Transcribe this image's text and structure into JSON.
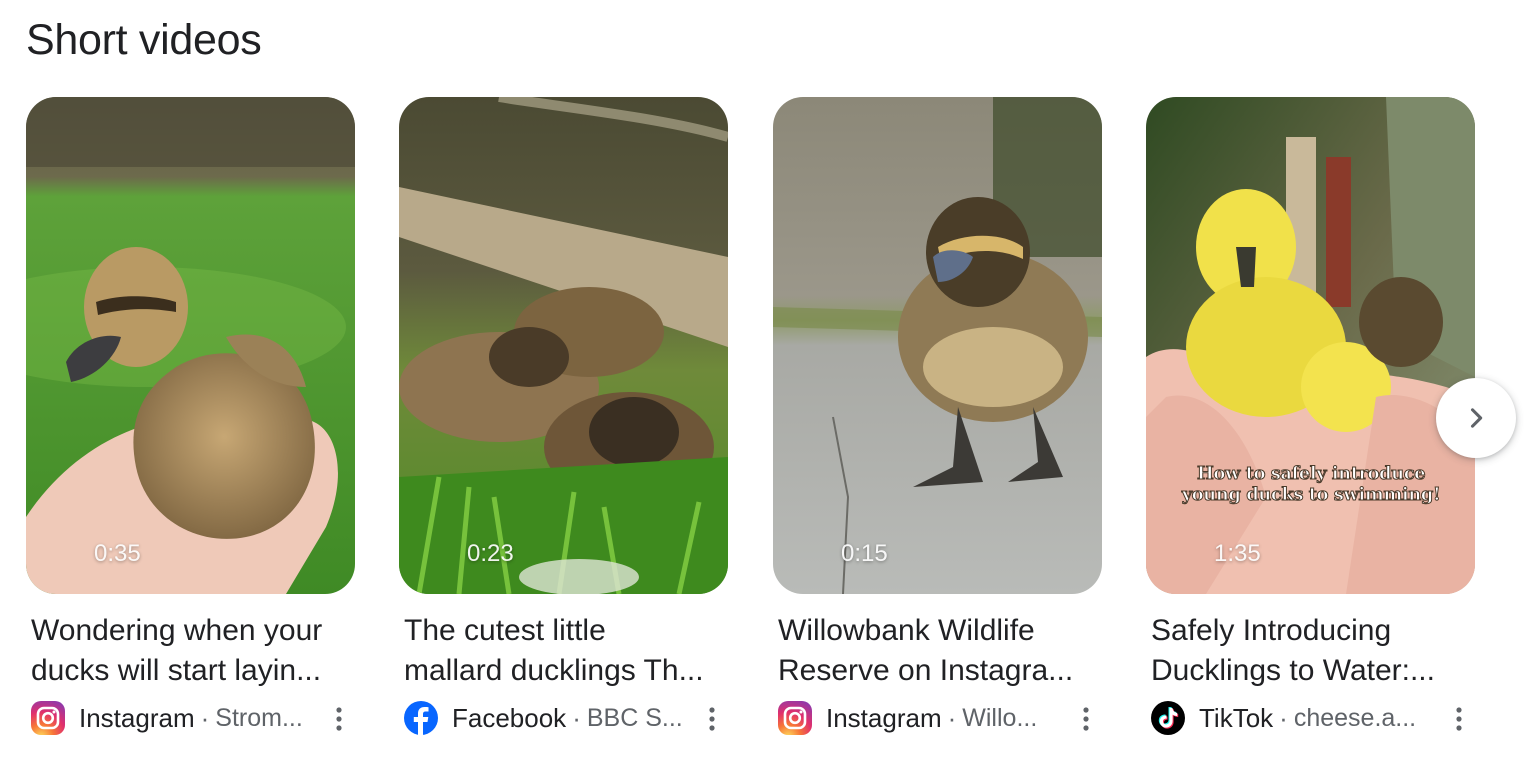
{
  "section": {
    "title": "Short videos"
  },
  "videos": [
    {
      "duration": "0:35",
      "title_line1": "Wondering when your",
      "title_line2": "ducks will start layin...",
      "source": "Instagram",
      "separator": "·",
      "author": "Strom...",
      "source_icon": "instagram-icon"
    },
    {
      "duration": "0:23",
      "title_line1": "The cutest little",
      "title_line2": "mallard ducklings Th...",
      "source": "Facebook",
      "separator": "·",
      "author": "BBC S...",
      "source_icon": "facebook-icon"
    },
    {
      "duration": "0:15",
      "title_line1": "Willowbank Wildlife",
      "title_line2": "Reserve on Instagra...",
      "source": "Instagram",
      "separator": "·",
      "author": "Willo...",
      "source_icon": "instagram-icon"
    },
    {
      "duration": "1:35",
      "overlay_caption": "How to safely introduce young ducks to swimming!",
      "title_line1": "Safely Introducing",
      "title_line2": "Ducklings to Water:...",
      "source": "TikTok",
      "separator": "·",
      "author": "cheese.a...",
      "source_icon": "tiktok-icon"
    }
  ],
  "carousel": {
    "next_icon": "chevron-right-icon"
  },
  "colors": {
    "title_text": "#202124",
    "secondary_text": "#5f6368",
    "facebook_blue": "#0866ff",
    "tiktok_black": "#000000"
  }
}
